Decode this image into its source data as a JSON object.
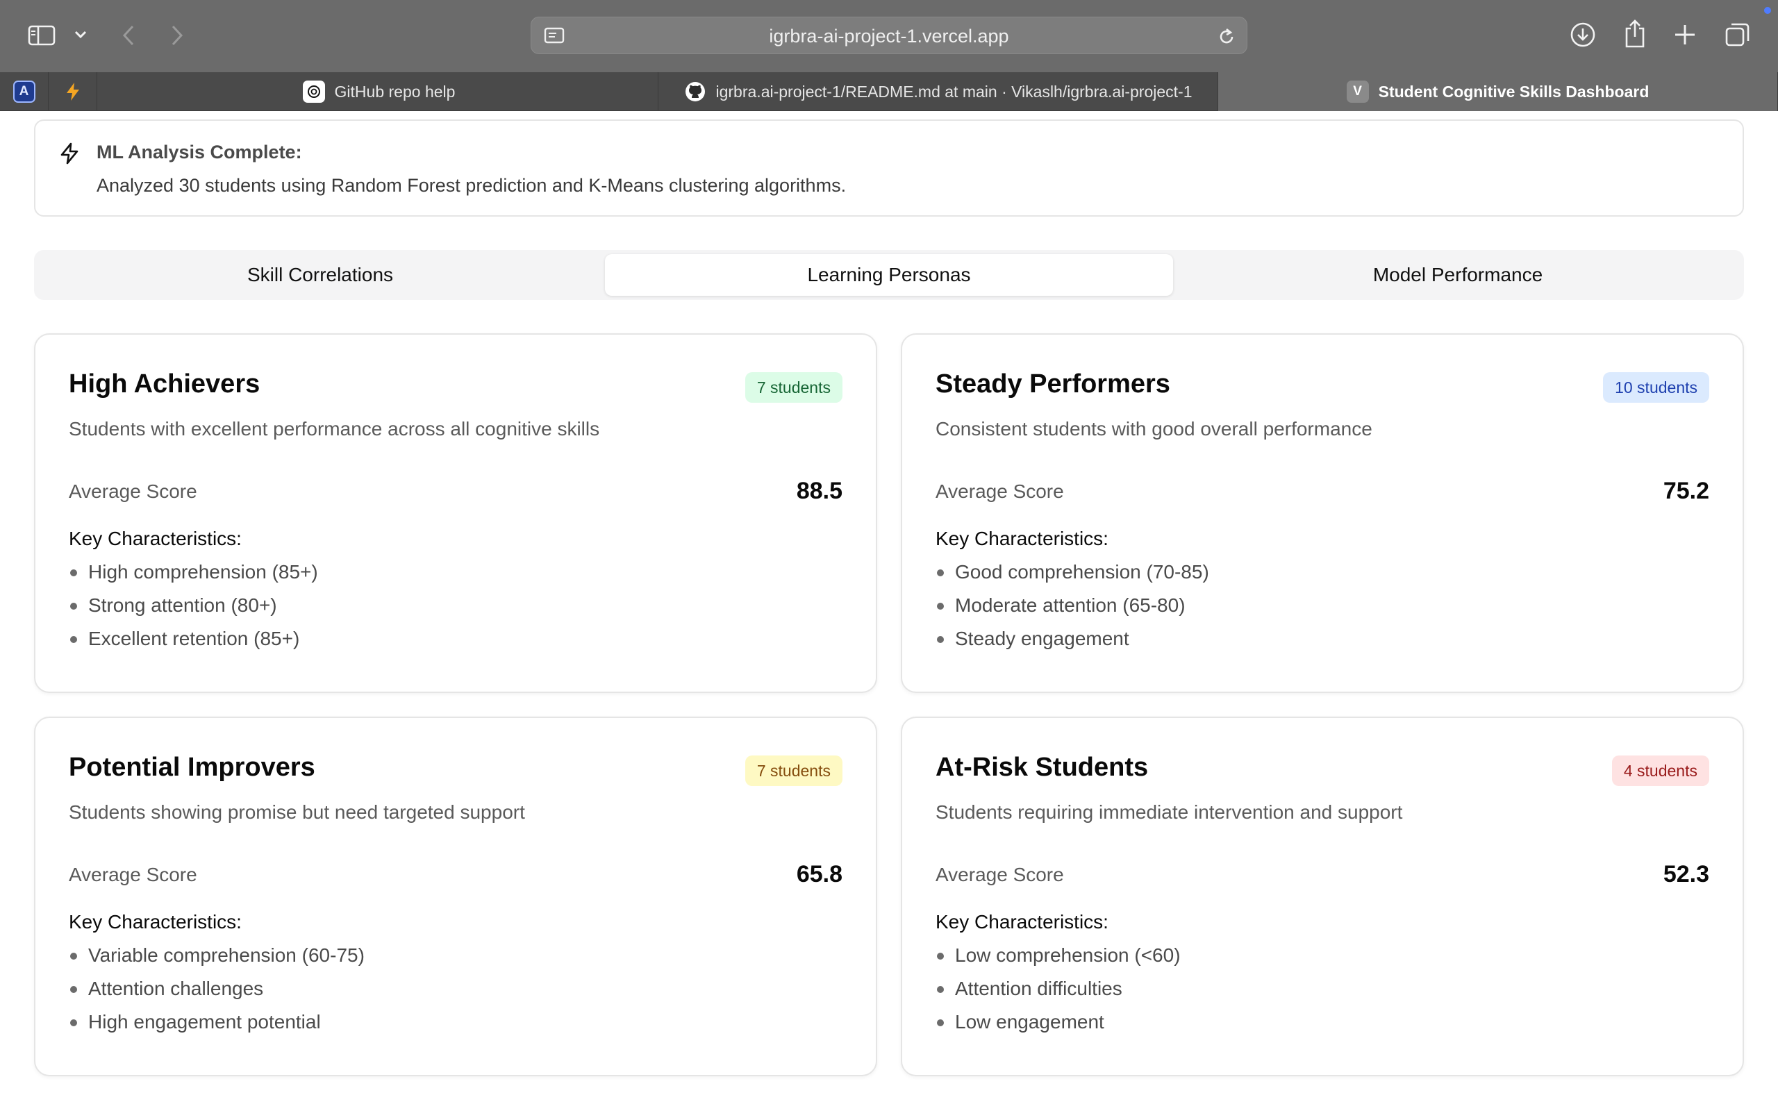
{
  "browser": {
    "url": "igrbra-ai-project-1.vercel.app",
    "tabs": [
      {
        "title": "GitHub repo help",
        "icon": "chatgpt-icon"
      },
      {
        "title": "igrbra.ai-project-1/README.md at main · Vikaslh/igrbra.ai-project-1",
        "icon": "github-icon"
      },
      {
        "title": "Student Cognitive Skills Dashboard",
        "icon": "v-favicon",
        "favicon_letter": "V",
        "active": true
      }
    ]
  },
  "alert": {
    "title": "ML Analysis Complete:",
    "description": "Analyzed 30 students using Random Forest prediction and K-Means clustering algorithms."
  },
  "tabs": [
    "Skill Correlations",
    "Learning Personas",
    "Model Performance"
  ],
  "selected_tab": "Learning Personas",
  "personas": [
    {
      "name": "High Achievers",
      "badge": "7 students",
      "badge_color": "#dcfce7",
      "badge_text_color": "#166534",
      "description": "Students with excellent performance across all cognitive skills",
      "avg_label": "Average Score",
      "avg_score": "88.5",
      "characteristics_title": "Key Characteristics:",
      "characteristics": [
        "High comprehension (85+)",
        "Strong attention (80+)",
        "Excellent retention (85+)"
      ]
    },
    {
      "name": "Steady Performers",
      "badge": "10 students",
      "badge_color": "#dbeafe",
      "badge_text_color": "#1e40af",
      "description": "Consistent students with good overall performance",
      "avg_label": "Average Score",
      "avg_score": "75.2",
      "characteristics_title": "Key Characteristics:",
      "characteristics": [
        "Good comprehension (70-85)",
        "Moderate attention (65-80)",
        "Steady engagement"
      ]
    },
    {
      "name": "Potential Improvers",
      "badge": "7 students",
      "badge_color": "#fef9c3",
      "badge_text_color": "#854d0e",
      "description": "Students showing promise but need targeted support",
      "avg_label": "Average Score",
      "avg_score": "65.8",
      "characteristics_title": "Key Characteristics:",
      "characteristics": [
        "Variable comprehension (60-75)",
        "Attention challenges",
        "High engagement potential"
      ]
    },
    {
      "name": "At-Risk Students",
      "badge": "4 students",
      "badge_color": "#fee2e2",
      "badge_text_color": "#991b1b",
      "description": "Students requiring immediate intervention and support",
      "avg_label": "Average Score",
      "avg_score": "52.3",
      "characteristics_title": "Key Characteristics:",
      "characteristics": [
        "Low comprehension (<60)",
        "Attention difficulties",
        "Low engagement"
      ]
    }
  ]
}
